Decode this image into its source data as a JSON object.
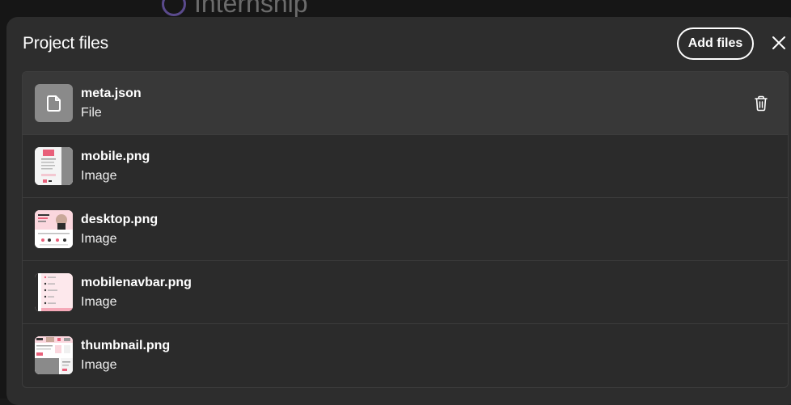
{
  "background": {
    "title": "Internship"
  },
  "modal": {
    "title": "Project files",
    "add_files_label": "Add files",
    "close_icon": "close-icon"
  },
  "files": [
    {
      "name": "meta.json",
      "type": "File",
      "icon": "file-icon",
      "selected": true
    },
    {
      "name": "mobile.png",
      "type": "Image",
      "icon": "image-thumbnail",
      "selected": false
    },
    {
      "name": "desktop.png",
      "type": "Image",
      "icon": "image-thumbnail",
      "selected": false
    },
    {
      "name": "mobilenavbar.png",
      "type": "Image",
      "icon": "image-thumbnail",
      "selected": false
    },
    {
      "name": "thumbnail.png",
      "type": "Image",
      "icon": "image-thumbnail",
      "selected": false
    }
  ],
  "colors": {
    "modal_bg": "#2d2d2d",
    "selected_row_bg": "#383838",
    "generic_icon_bg": "#8a8a8a",
    "accent_pink": "#e8607a"
  }
}
